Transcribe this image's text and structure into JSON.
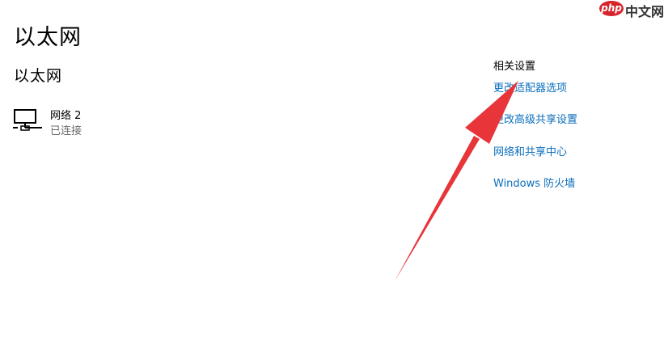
{
  "page": {
    "title": "以太网",
    "section_title": "以太网"
  },
  "network": {
    "name": "网络 2",
    "status": "已连接",
    "icon": "ethernet-computer-icon"
  },
  "related_settings": {
    "title": "相关设置",
    "links": [
      "更改适配器选项",
      "更改高级共享设置",
      "网络和共享中心",
      "Windows 防火墙"
    ]
  },
  "watermark": {
    "badge": "php",
    "text": "中文网"
  },
  "annotation": {
    "arrow_color": "#e8353a"
  },
  "colors": {
    "link": "#0a6ebd",
    "secondary_text": "#6b6b6b"
  }
}
